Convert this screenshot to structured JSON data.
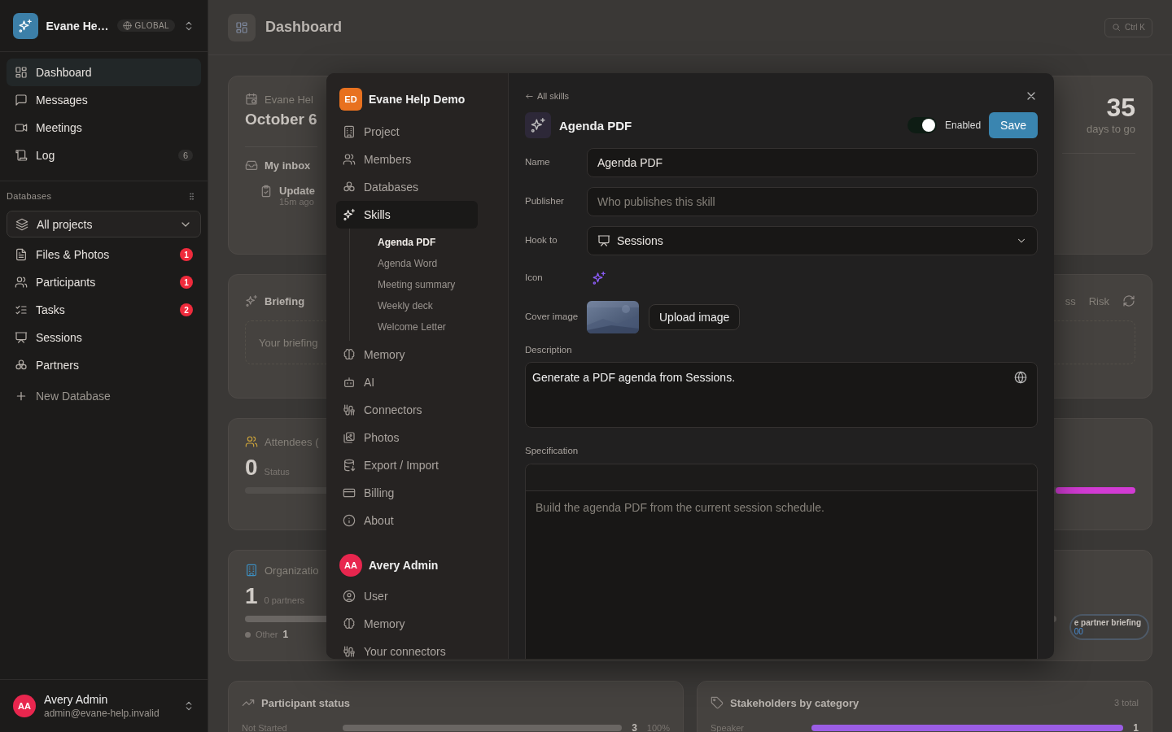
{
  "sidebar": {
    "workspace": "Evane He…",
    "scope": "GLOBAL",
    "nav": [
      {
        "label": "Dashboard",
        "selected": true
      },
      {
        "label": "Messages",
        "selected": false
      },
      {
        "label": "Meetings",
        "selected": false
      },
      {
        "label": "Log",
        "count": "6",
        "selected": false
      }
    ],
    "section_title": "Databases",
    "project_filter": "All projects",
    "databases": [
      {
        "label": "Files & Photos",
        "badge": "1"
      },
      {
        "label": "Participants",
        "badge": "1"
      },
      {
        "label": "Tasks",
        "badge": "2"
      },
      {
        "label": "Sessions"
      },
      {
        "label": "Partners"
      }
    ],
    "new_database": "New Database",
    "user": {
      "initials": "AA",
      "name": "Avery Admin",
      "email": "admin@evane-help.invalid"
    }
  },
  "header": {
    "title": "Dashboard",
    "search_shortcut": "Ctrl K"
  },
  "dashboard": {
    "event_card": {
      "project": "Evane Hel",
      "date": "October 6",
      "inbox_title": "My inbox",
      "inbox_item": "Update",
      "inbox_time": "15m ago",
      "countdown": "35",
      "countdown_label": "days to go"
    },
    "briefing_card": {
      "title": "Briefing",
      "placeholder": "Your briefing",
      "tabs": [
        "ss",
        "Risk"
      ]
    },
    "attendees_card": {
      "title": "Attendees (",
      "count": "0",
      "count_label": "Status",
      "level": 0.09
    },
    "organizations_card": {
      "title": "Organizatio",
      "count": "1",
      "count_label": "0 partners",
      "level": 1,
      "legend": [
        {
          "label": "Other",
          "value": "1"
        }
      ],
      "briefing_button": "e partner briefing",
      "briefing_sub": "00"
    },
    "participant_status": {
      "title": "Participant status",
      "rows": [
        {
          "label": "Not Started",
          "level": 1,
          "count": "3",
          "share": "100%"
        }
      ]
    },
    "stakeholders": {
      "title": "Stakeholders by category",
      "total": "3 total",
      "rows": [
        {
          "label": "Speaker",
          "level": 1,
          "count": "1"
        }
      ]
    }
  },
  "modal": {
    "project": {
      "initials": "ED",
      "name": "Evane Help Demo"
    },
    "project_nav": [
      {
        "label": "Project",
        "selected": false
      },
      {
        "label": "Members",
        "selected": false
      },
      {
        "label": "Databases",
        "selected": false
      },
      {
        "label": "Skills",
        "selected": true,
        "children": [
          {
            "label": "Agenda PDF",
            "selected": true
          },
          {
            "label": "Agenda Word",
            "selected": false
          },
          {
            "label": "Meeting summary",
            "selected": false
          },
          {
            "label": "Weekly deck",
            "selected": false
          },
          {
            "label": "Welcome Letter",
            "selected": false
          }
        ]
      },
      {
        "label": "Memory",
        "selected": false
      },
      {
        "label": "AI",
        "selected": false
      },
      {
        "label": "Connectors",
        "selected": false
      },
      {
        "label": "Photos",
        "selected": false
      },
      {
        "label": "Export / Import",
        "selected": false
      },
      {
        "label": "Billing",
        "selected": false
      },
      {
        "label": "About",
        "selected": false
      }
    ],
    "account": {
      "initials": "AA",
      "name": "Avery Admin"
    },
    "account_nav": [
      {
        "label": "User",
        "selected": false
      },
      {
        "label": "Memory",
        "selected": false
      },
      {
        "label": "Your connectors",
        "selected": false
      }
    ],
    "back_link": "All skills",
    "skill": {
      "title": "Agenda PDF",
      "enabled": true,
      "enabled_label": "Enabled",
      "save": "Save",
      "fields": [
        {
          "kind": "input",
          "label": "Name",
          "value": "Agenda PDF"
        },
        {
          "kind": "input",
          "label": "Publisher",
          "placeholder": "Who publishes this skill"
        },
        {
          "kind": "select",
          "label": "Hook to",
          "value": "Sessions"
        },
        {
          "kind": "icon",
          "label": "Icon"
        },
        {
          "label": "Cover image",
          "button": "Upload image"
        }
      ],
      "description_label": "Description",
      "description": "Generate a PDF agenda from Sessions.",
      "specification_label": "Specification",
      "specification_placeholder": "Build the agenda PDF from the current session schedule."
    }
  }
}
